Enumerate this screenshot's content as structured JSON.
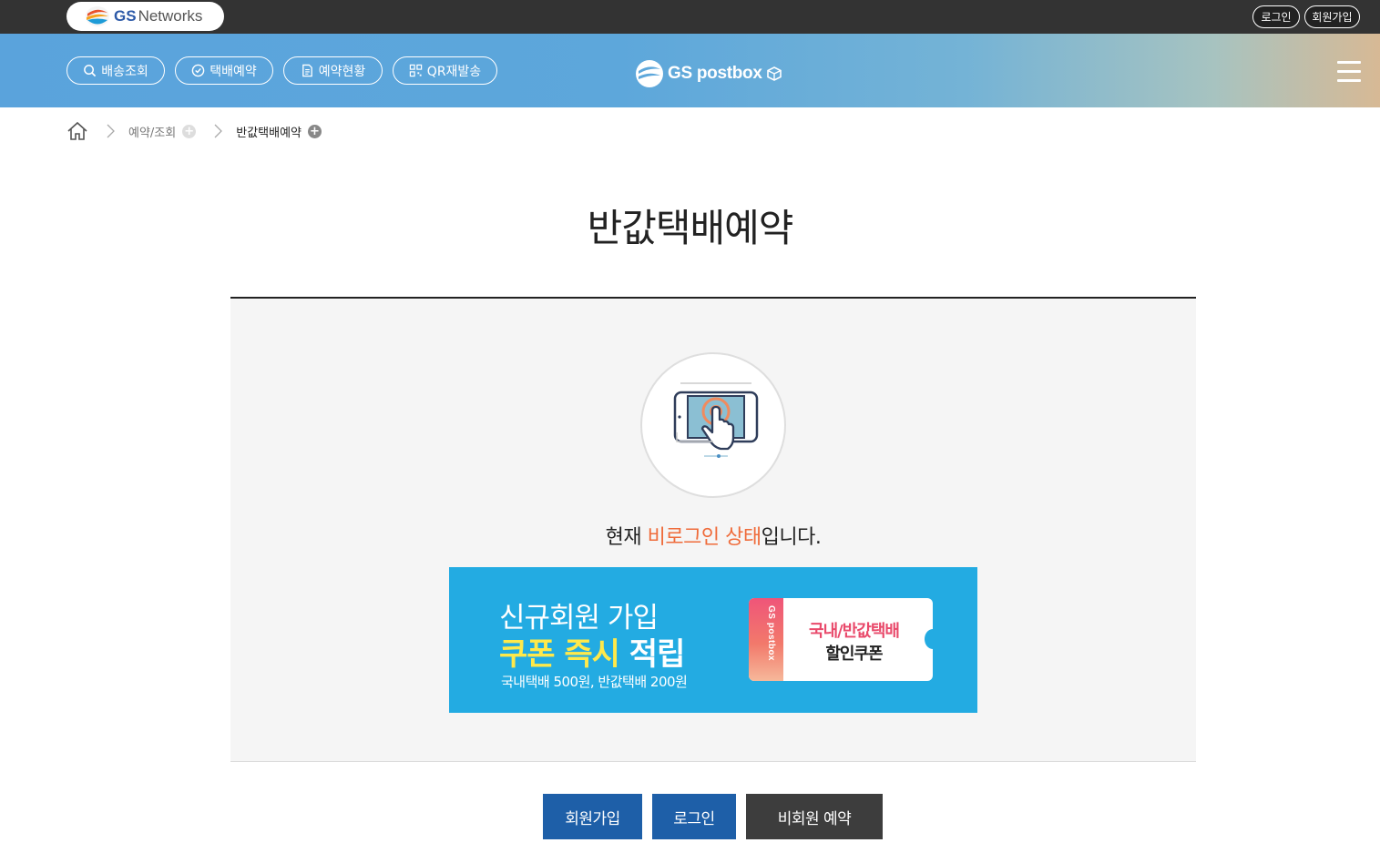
{
  "topbar": {
    "logo_gs": "GS",
    "logo_networks": "Networks",
    "login_label": "로그인",
    "join_label": "회원가입"
  },
  "nav": {
    "items": [
      {
        "label": "배송조회",
        "icon": "search-icon"
      },
      {
        "label": "택배예약",
        "icon": "clock-icon"
      },
      {
        "label": "예약현황",
        "icon": "document-icon"
      },
      {
        "label": "QR재발송",
        "icon": "qr-icon"
      }
    ],
    "brand": "GS postbox",
    "menu_icon": "hamburger-icon"
  },
  "breadcrumb": {
    "home_icon": "home-icon",
    "items": [
      "예약/조회",
      "반값택배예약"
    ]
  },
  "page": {
    "title": "반값택배예약",
    "status_prefix": "현재 ",
    "status_highlight": "비로그인 상태",
    "status_suffix": "입니다.",
    "illustration_icon": "tablet-touch-icon"
  },
  "banner": {
    "line1": "신규회원 가입",
    "line2_highlight": "쿠폰 즉시",
    "line2_rest": " 적립",
    "line3": "국내택배 500원, 반값택배 200원",
    "coupon_stub": "GS postbox",
    "coupon_line1": "국내/반값택배",
    "coupon_line2": "할인쿠폰"
  },
  "actions": {
    "join": "회원가입",
    "login": "로그인",
    "guest": "비회원 예약"
  },
  "colors": {
    "topbar_bg": "#333333",
    "nav_gradient_start": "#5aa3dc",
    "nav_gradient_end": "#d7b995",
    "highlight": "#ef6b3a",
    "banner_bg": "#23abe2",
    "banner_highlight": "#ffe94a",
    "primary_button": "#1e5fa8",
    "dark_button": "#3d3d3d"
  }
}
